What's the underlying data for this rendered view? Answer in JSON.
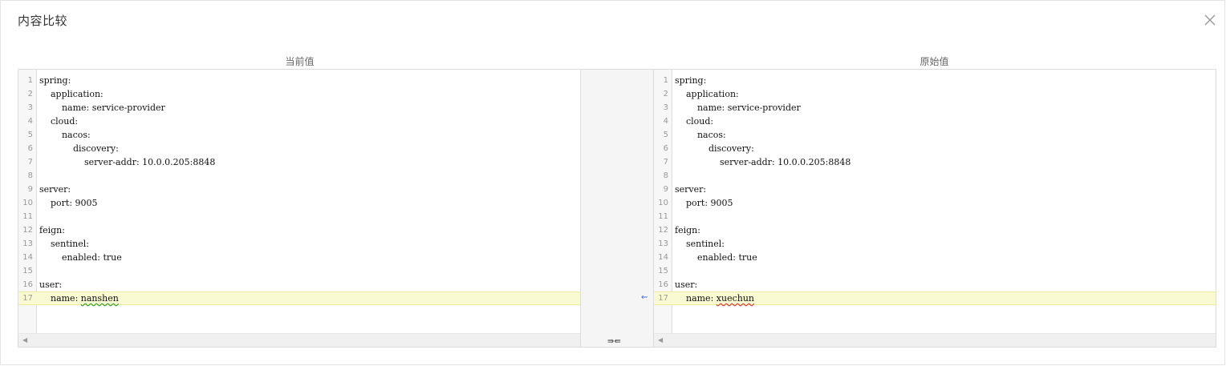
{
  "dialog": {
    "title": "内容比较"
  },
  "panes": {
    "current": {
      "header": "当前值",
      "lines": [
        {
          "num": "1",
          "text": "spring:"
        },
        {
          "num": "2",
          "text": "    application:"
        },
        {
          "num": "3",
          "text": "        name: service-provider"
        },
        {
          "num": "4",
          "text": "    cloud:"
        },
        {
          "num": "5",
          "text": "        nacos:"
        },
        {
          "num": "6",
          "text": "            discovery:"
        },
        {
          "num": "7",
          "text": "                server-addr: 10.0.0.205:8848"
        },
        {
          "num": "8",
          "text": ""
        },
        {
          "num": "9",
          "text": "server:"
        },
        {
          "num": "10",
          "text": "    port: 9005"
        },
        {
          "num": "11",
          "text": ""
        },
        {
          "num": "12",
          "text": "feign:"
        },
        {
          "num": "13",
          "text": "    sentinel:"
        },
        {
          "num": "14",
          "text": "        enabled: true"
        },
        {
          "num": "15",
          "text": ""
        },
        {
          "num": "16",
          "text": "user:"
        },
        {
          "num": "17",
          "prefix": "    name: ",
          "value": "nanshen"
        }
      ]
    },
    "original": {
      "header": "原始值",
      "lines": [
        {
          "num": "1",
          "text": "spring:"
        },
        {
          "num": "2",
          "text": "    application:"
        },
        {
          "num": "3",
          "text": "        name: service-provider"
        },
        {
          "num": "4",
          "text": "    cloud:"
        },
        {
          "num": "5",
          "text": "        nacos:"
        },
        {
          "num": "6",
          "text": "            discovery:"
        },
        {
          "num": "7",
          "text": "                server-addr: 10.0.0.205:8848"
        },
        {
          "num": "8",
          "text": ""
        },
        {
          "num": "9",
          "text": "server:"
        },
        {
          "num": "10",
          "text": "    port: 9005"
        },
        {
          "num": "11",
          "text": ""
        },
        {
          "num": "12",
          "text": "feign:"
        },
        {
          "num": "13",
          "text": "    sentinel:"
        },
        {
          "num": "14",
          "text": "        enabled: true"
        },
        {
          "num": "15",
          "text": ""
        },
        {
          "num": "16",
          "text": "user:"
        },
        {
          "num": "17",
          "prefix": "    name: ",
          "value": "xuechun"
        }
      ]
    }
  },
  "middle": {
    "merge_arrow": "⇜",
    "swap_label": "⇛⇚"
  },
  "icons": {
    "close": "close-icon",
    "scroll_left": "scroll-left-icon"
  },
  "colors": {
    "changed_line_bg": "#fafad2",
    "merge_arrow": "#4a6ee0"
  }
}
